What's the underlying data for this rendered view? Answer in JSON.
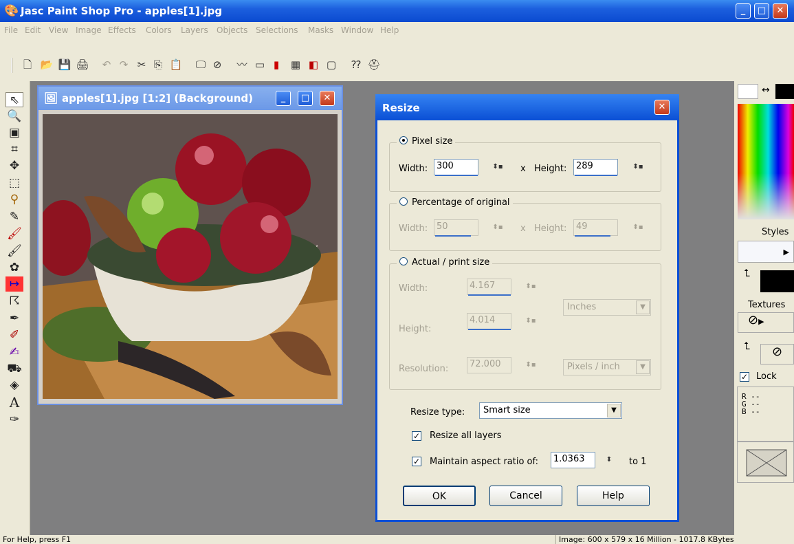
{
  "app": {
    "title": "Jasc Paint Shop Pro - apples[1].jpg",
    "title_buttons": {
      "minimize": "_",
      "maximize": "□",
      "close": "✕"
    }
  },
  "menu": [
    "File",
    "Edit",
    "View",
    "Image",
    "Effects",
    "Colors",
    "Layers",
    "Objects",
    "Selections",
    "Masks",
    "Window",
    "Help"
  ],
  "image_window": {
    "title": "apples[1].jpg [1:2] (Background)"
  },
  "dialog": {
    "title": "Resize",
    "pixel_size": {
      "label": "Pixel size",
      "width_label": "Width:",
      "width_value": "300",
      "x_label": "x",
      "height_label": "Height:",
      "height_value": "289"
    },
    "percentage": {
      "label": "Percentage of original",
      "width_label": "Width:",
      "width_value": "50",
      "x_label": "x",
      "height_label": "Height:",
      "height_value": "49"
    },
    "print_size": {
      "label": "Actual / print size",
      "width_label": "Width:",
      "width_value": "4.167",
      "height_label": "Height:",
      "height_value": "4.014",
      "units": "Inches",
      "resolution_label": "Resolution:",
      "resolution_value": "72.000",
      "resolution_units": "Pixels / inch"
    },
    "resize_type_label": "Resize type:",
    "resize_type_value": "Smart size",
    "resize_all_layers": "Resize all layers",
    "maintain_aspect": "Maintain aspect ratio of:",
    "aspect_value": "1.0363",
    "to_one": "to 1",
    "ok": "OK",
    "cancel": "Cancel",
    "help": "Help"
  },
  "right_panel": {
    "styles": "Styles",
    "textures": "Textures",
    "lock": "Lock",
    "r": "R",
    "g": "G",
    "b": "B",
    "dash": "--"
  },
  "status": {
    "left": "For Help, press F1",
    "right": "Image:  600 x 579 x 16 Million - 1017.8 KBytes"
  },
  "colors": {
    "title_blue": "#0a4ad0",
    "workspace_gray": "#7f7f80",
    "panel_beige": "#ece9d8"
  }
}
